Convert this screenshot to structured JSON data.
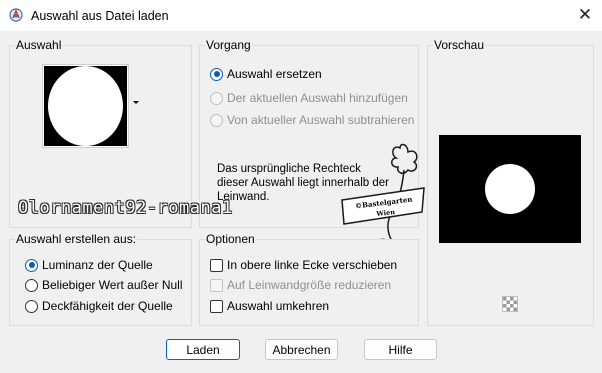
{
  "window": {
    "title": "Auswahl aus Datei laden",
    "close_icon": "close-icon",
    "app_icon": "paintshop-app-icon"
  },
  "auswahl": {
    "label": "Auswahl"
  },
  "vorgang": {
    "label": "Vorgang",
    "options": [
      {
        "label": "Auswahl ersetzen",
        "selected": true,
        "enabled": true
      },
      {
        "label": "Der aktuellen Auswahl hinzufügen",
        "selected": false,
        "enabled": false
      },
      {
        "label": "Von aktueller Auswahl subtrahieren",
        "selected": false,
        "enabled": false
      }
    ],
    "info": "Das ursprüngliche Rechteck dieser Auswahl liegt innerhalb der Leinwand."
  },
  "vorschau": {
    "label": "Vorschau"
  },
  "watermark": "0lornament92-romana1",
  "logo_text": [
    "©Bastelgarten",
    "Wien"
  ],
  "erstellen": {
    "label": "Auswahl erstellen aus:",
    "options": [
      {
        "label": "Luminanz der Quelle",
        "selected": true
      },
      {
        "label": "Beliebiger Wert außer Null",
        "selected": false
      },
      {
        "label": "Deckfähigkeit der Quelle",
        "selected": false
      }
    ]
  },
  "optionen": {
    "label": "Optionen",
    "items": [
      {
        "label": "In obere linke Ecke verschieben",
        "checked": false,
        "enabled": true
      },
      {
        "label": "Auf Leinwandgröße reduzieren",
        "checked": false,
        "enabled": false
      },
      {
        "label": "Auswahl umkehren",
        "checked": false,
        "enabled": true
      }
    ]
  },
  "buttons": {
    "load": "Laden",
    "cancel": "Abbrechen",
    "help": "Hilfe"
  },
  "colors": {
    "accent": "#0a5fb4",
    "primary_border": "#0067c0",
    "background": "#f0f0f0"
  }
}
